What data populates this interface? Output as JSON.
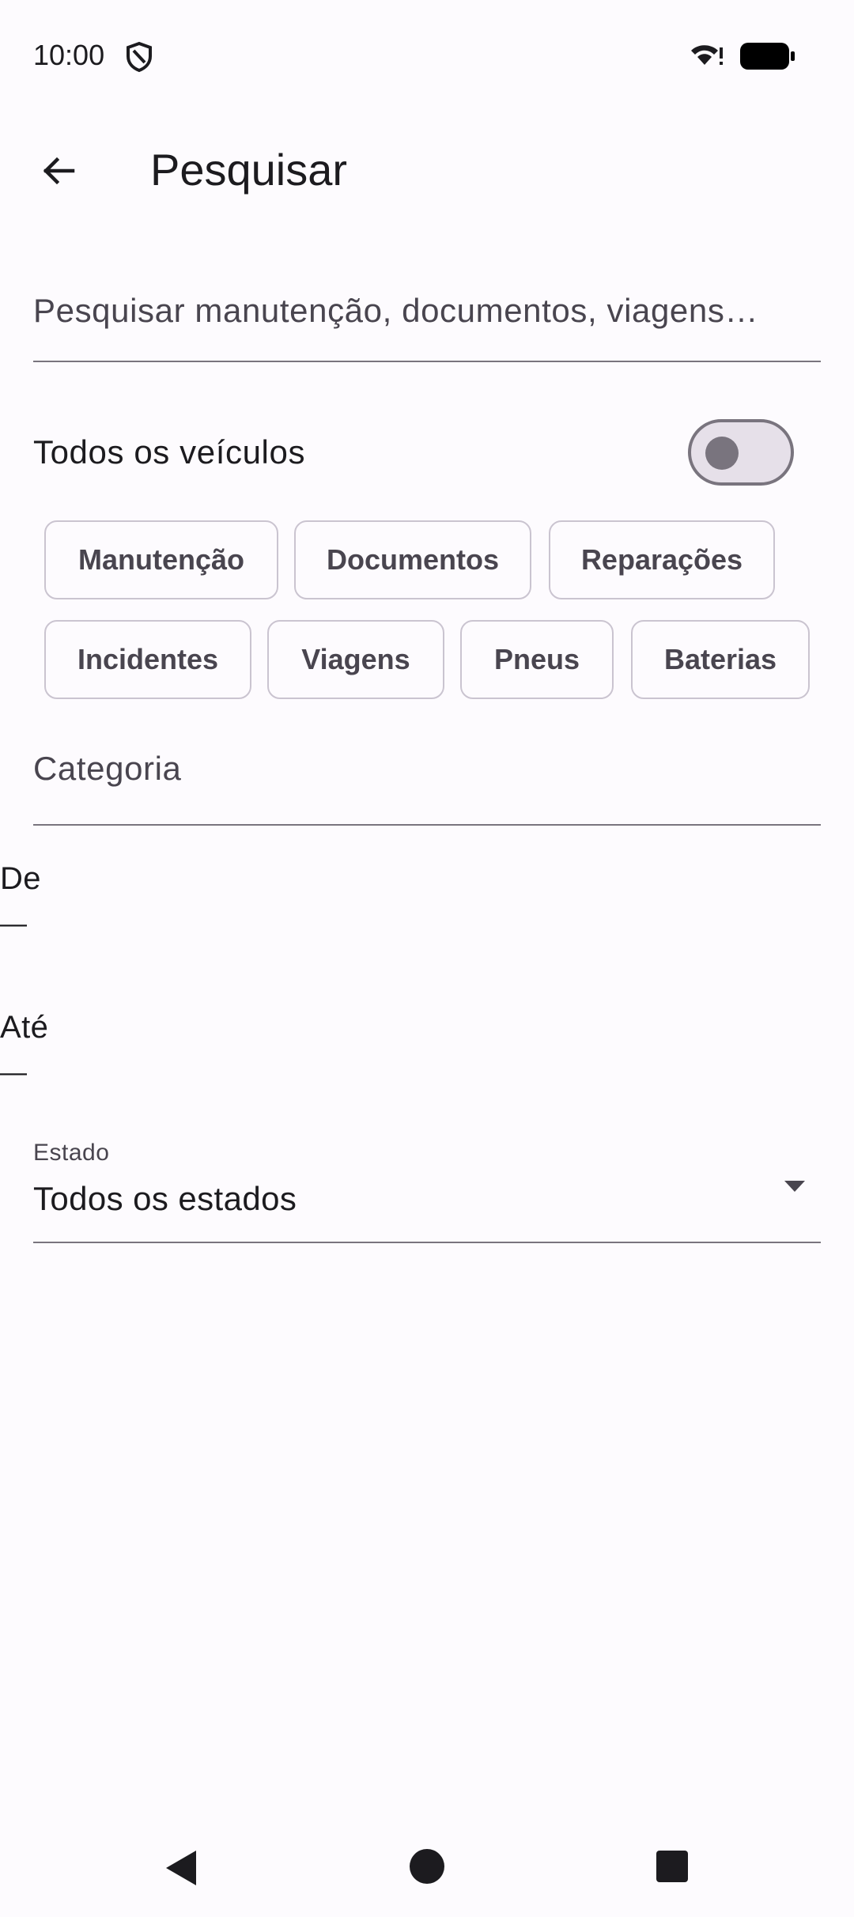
{
  "status_bar": {
    "time": "10:00",
    "icons": [
      "shield-icon",
      "wifi-icon",
      "battery-icon"
    ]
  },
  "app_bar": {
    "back_icon": "arrow-back-icon",
    "title": "Pesquisar"
  },
  "search": {
    "value": "",
    "placeholder": "Pesquisar manutenção, documentos, viagens…"
  },
  "vehicles_toggle": {
    "label": "Todos os veículos",
    "on": false
  },
  "filter_chips": [
    {
      "label": "Manutenção",
      "selected": false
    },
    {
      "label": "Documentos",
      "selected": false
    },
    {
      "label": "Reparações",
      "selected": false
    },
    {
      "label": "Incidentes",
      "selected": false
    },
    {
      "label": "Viagens",
      "selected": false
    },
    {
      "label": "Pneus",
      "selected": false
    },
    {
      "label": "Baterias",
      "selected": false
    }
  ],
  "category": {
    "label": "Categoria"
  },
  "date_from": {
    "label": "De",
    "value": "—"
  },
  "date_to": {
    "label": "Até",
    "value": "—"
  },
  "estado": {
    "label": "Estado",
    "value": "Todos os estados"
  },
  "nav_bar": {
    "icons": [
      "nav-back-icon",
      "nav-home-icon",
      "nav-recents-icon"
    ]
  },
  "colors": {
    "background": "#fdfbfe",
    "outline": "#79747e",
    "chip_border": "#cac4d0",
    "text": "#1c1b1f"
  }
}
